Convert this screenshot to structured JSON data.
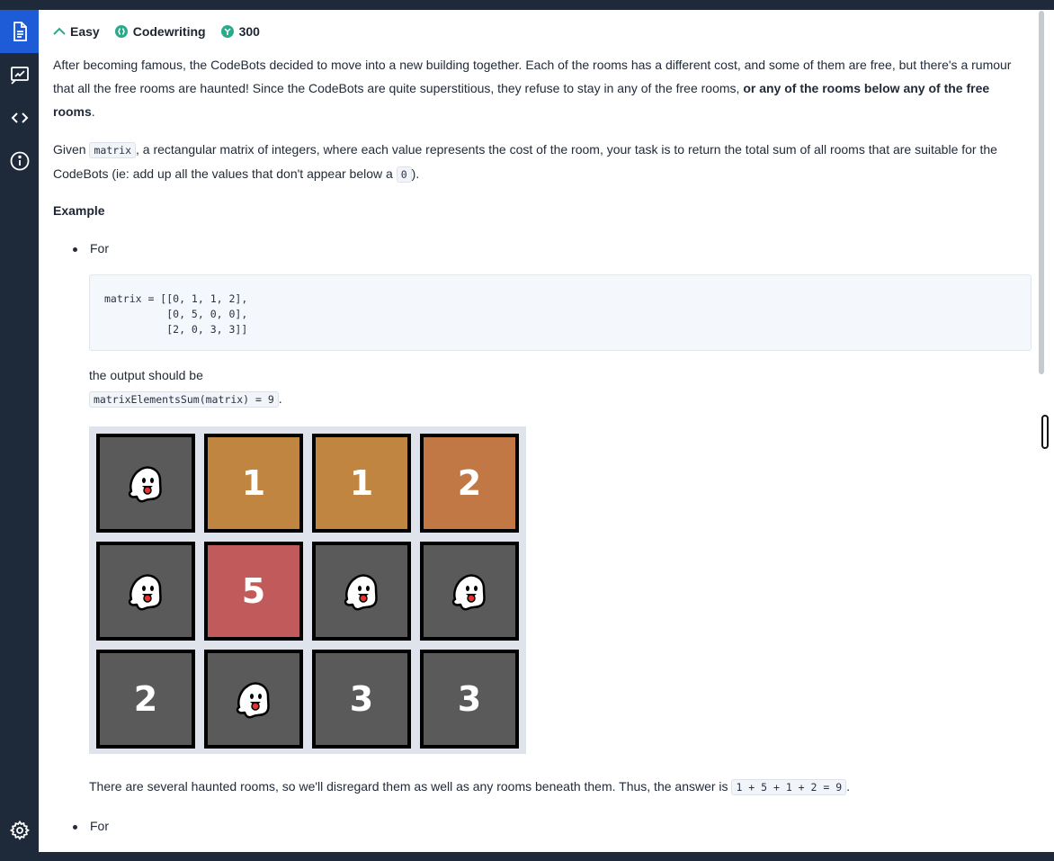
{
  "sidebar": {
    "items": [
      {
        "name": "description",
        "icon": "document-icon",
        "active": true
      },
      {
        "name": "solutions",
        "icon": "edit-chart-icon",
        "active": false
      },
      {
        "name": "code",
        "icon": "code-brackets-icon",
        "active": false
      },
      {
        "name": "info",
        "icon": "info-icon",
        "active": false
      }
    ],
    "settings_icon": "gear-icon"
  },
  "task": {
    "difficulty": "Easy",
    "type": "Codewriting",
    "points": "300"
  },
  "description": {
    "p1_text": "After becoming famous, the CodeBots decided to move into a new building together. Each of the rooms has a different cost, and some of them are free, but there's a rumour that all the free rooms are haunted! Since the CodeBots are quite superstitious, they refuse to stay in any of the free rooms,",
    "p1_bold": "or any of the rooms below any of the free rooms",
    "p1_end": ".",
    "p2_start": "Given",
    "p2_code": "matrix",
    "p2_mid": ", a rectangular matrix of integers, where each value represents the cost of the room, your task is to return the total sum of all rooms that are suitable for the CodeBots (ie: add up all the values that don't appear below a",
    "p2_zero": "0",
    "p2_end": ")."
  },
  "example": {
    "heading": "Example",
    "bullet1": "For",
    "code": "matrix = [[0, 1, 1, 2],\n          [0, 5, 0, 0],\n          [2, 0, 3, 3]]",
    "output_label": "the output should be",
    "output_code": "matrixElementsSum(matrix) = 9",
    "output_end": ".",
    "explanation": "There are several haunted rooms, so we'll disregard them as well as any rooms beneath them. Thus, the answer is",
    "explanation_code": "1 + 5 + 1 + 2 = 9",
    "explanation_end": ".",
    "bullet2": "For"
  },
  "room_grid": {
    "rows": [
      [
        {
          "value": "ghost",
          "color": "#5a5a5a"
        },
        {
          "value": "1",
          "color": "#c08540"
        },
        {
          "value": "1",
          "color": "#c08540"
        },
        {
          "value": "2",
          "color": "#c27844"
        }
      ],
      [
        {
          "value": "ghost",
          "color": "#5a5a5a"
        },
        {
          "value": "5",
          "color": "#c15a5a"
        },
        {
          "value": "ghost",
          "color": "#5a5a5a"
        },
        {
          "value": "ghost",
          "color": "#5a5a5a"
        }
      ],
      [
        {
          "value": "2",
          "color": "#5a5a5a"
        },
        {
          "value": "ghost",
          "color": "#5a5a5a"
        },
        {
          "value": "3",
          "color": "#5a5a5a"
        },
        {
          "value": "3",
          "color": "#5a5a5a"
        }
      ]
    ],
    "ghost_icon": "ghost-icon"
  },
  "colors": {
    "sidebar_bg": "#1e2a3a",
    "sidebar_active": "#1e5bd6",
    "accent_green": "#2aaa8a"
  }
}
